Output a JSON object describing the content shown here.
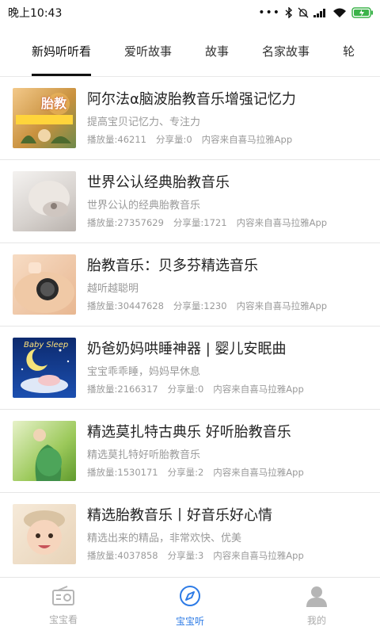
{
  "status_bar": {
    "time": "晚上10:43"
  },
  "tabs": [
    {
      "label": "新妈听听看",
      "active": true
    },
    {
      "label": "爱听故事",
      "active": false
    },
    {
      "label": "故事",
      "active": false
    },
    {
      "label": "名家故事",
      "active": false
    },
    {
      "label": "轮",
      "active": false
    }
  ],
  "items": [
    {
      "title": "阿尔法α脑波胎教音乐增强记忆力",
      "subtitle": "提高宝贝记忆力、专注力",
      "plays": "播放量:46211",
      "shares": "分享量:0",
      "source": "内容来自喜马拉雅App",
      "thumb_text": "胎教"
    },
    {
      "title": "世界公认经典胎教音乐",
      "subtitle": "世界公认的经典胎教音乐",
      "plays": "播放量:27357629",
      "shares": "分享量:1721",
      "source": "内容来自喜马拉雅App"
    },
    {
      "title": "胎教音乐：贝多芬精选音乐",
      "subtitle": "越听越聪明",
      "plays": "播放量:30447628",
      "shares": "分享量:1230",
      "source": "内容来自喜马拉雅App"
    },
    {
      "title": "奶爸奶妈哄睡神器 | 婴儿安眠曲",
      "subtitle": "宝宝乖乖睡，妈妈早休息",
      "plays": "播放量:2166317",
      "shares": "分享量:0",
      "source": "内容来自喜马拉雅App",
      "thumb_text": "Baby Sleep"
    },
    {
      "title": "精选莫扎特古典乐 好听胎教音乐",
      "subtitle": "精选莫扎特好听胎教音乐",
      "plays": "播放量:1530171",
      "shares": "分享量:2",
      "source": "内容来自喜马拉雅App"
    },
    {
      "title": "精选胎教音乐丨好音乐好心情",
      "subtitle": "精选出来的精品，非常欢快、优美",
      "plays": "播放量:4037858",
      "shares": "分享量:3",
      "source": "内容来自喜马拉雅App"
    }
  ],
  "bottom_nav": [
    {
      "label": "宝宝看",
      "icon": "radio-icon",
      "active": false
    },
    {
      "label": "宝宝听",
      "icon": "compass-icon",
      "active": true
    },
    {
      "label": "我的",
      "icon": "user-icon",
      "active": false
    }
  ],
  "colors": {
    "accent": "#2d7be6",
    "text_secondary": "#9a9a9a",
    "battery": "#3cb34a"
  }
}
